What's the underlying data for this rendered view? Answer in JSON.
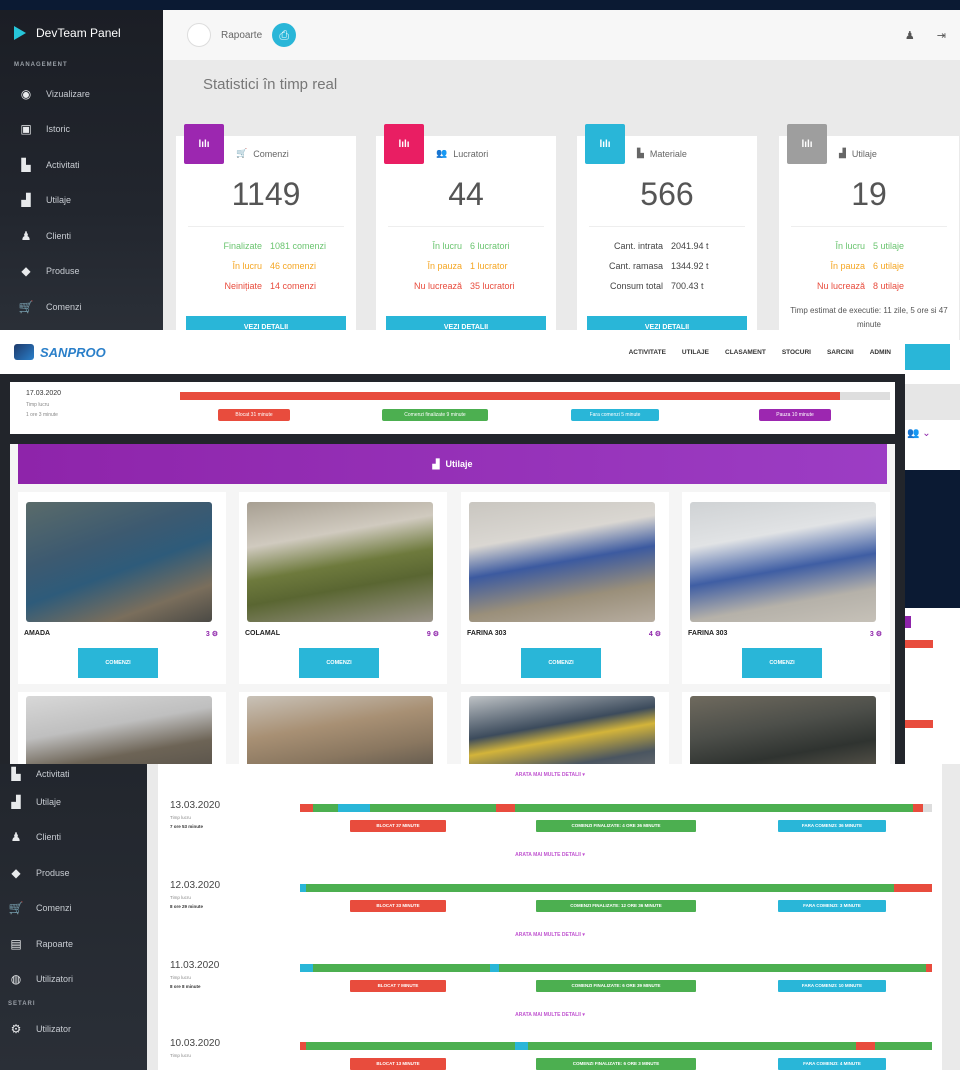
{
  "dashboard": {
    "brand": "DevTeam Panel",
    "section": "MANAGEMENT",
    "nav": [
      {
        "label": "Vizualizare",
        "icon": "eye-icon",
        "glyph": "◉"
      },
      {
        "label": "Istoric",
        "icon": "clipboard-icon",
        "glyph": "▣"
      },
      {
        "label": "Activitati",
        "icon": "chart-icon",
        "glyph": "▙"
      },
      {
        "label": "Utilaje",
        "icon": "factory-icon",
        "glyph": "▟"
      },
      {
        "label": "Clienti",
        "icon": "user-icon",
        "glyph": "♟"
      },
      {
        "label": "Produse",
        "icon": "tag-icon",
        "glyph": "◆"
      },
      {
        "label": "Comenzi",
        "icon": "cart-icon",
        "glyph": "🛒"
      }
    ],
    "top_label": "Rapoarte",
    "title": "Statistici în timp real",
    "cards": [
      {
        "title": "Comenzi",
        "value": "1149",
        "color": "#9c27b0",
        "head_icon": "🛒",
        "rows": [
          [
            "Finalizate",
            "1081 comenzi",
            "green"
          ],
          [
            "În lucru",
            "46 comenzi",
            "orange"
          ],
          [
            "Neinițiate",
            "14 comenzi",
            "red"
          ]
        ],
        "note": "",
        "btn": "VEZI DETALII"
      },
      {
        "title": "Lucratori",
        "value": "44",
        "color": "#e91e63",
        "head_icon": "👥",
        "rows": [
          [
            "În lucru",
            "6 lucratori",
            "green"
          ],
          [
            "În pauza",
            "1 lucrator",
            "orange"
          ],
          [
            "Nu lucrează",
            "35 lucratori",
            "red"
          ]
        ],
        "note": "",
        "btn": "VEZI DETALII"
      },
      {
        "title": "Materiale",
        "value": "566",
        "color": "#29b6d8",
        "head_icon": "▙",
        "rows": [
          [
            "Cant. intrata",
            "2041.94 t",
            "gray"
          ],
          [
            "Cant. ramasa",
            "1344.92 t",
            "gray"
          ],
          [
            "Consum total",
            "700.43 t",
            "gray"
          ]
        ],
        "note": "",
        "btn": "VEZI DETALII"
      },
      {
        "title": "Utilaje",
        "value": "19",
        "color": "#9e9e9e",
        "head_icon": "▟",
        "rows": [
          [
            "În lucru",
            "5 utilaje",
            "green"
          ],
          [
            "În pauza",
            "6 utilaje",
            "orange"
          ],
          [
            "Nu lucrează",
            "8 utilaje",
            "red"
          ]
        ],
        "note": "Timp estimat de executie: 11 zile, 5 ore si 47 minute",
        "btn": ""
      }
    ]
  },
  "utilaje_view": {
    "brand": "SANPROO",
    "nav": [
      "ACTIVITATE",
      "UTILAJE",
      "CLASAMENT",
      "STOCURI",
      "SARCINI",
      "ADMIN"
    ],
    "timeline": {
      "date": "17.03.2020",
      "sub1": "Timp lucru",
      "sub2": "1 ore 3 minute",
      "badges": [
        "Blocat 31 minute",
        "Comenzi finalizate 9 minute",
        "Fara comenzi 5 minute",
        "Pauza 10 minute"
      ]
    },
    "header": "Utilaje",
    "machines": [
      {
        "name": "AMADA",
        "count": "3 ⚙"
      },
      {
        "name": "COLAMAL",
        "count": "9 ⚙"
      },
      {
        "name": "FARINA 303",
        "count": "4 ⚙"
      },
      {
        "name": "FARINA 303",
        "count": "3 ⚙"
      }
    ],
    "machine_btn": "COMENZI"
  },
  "history": {
    "section": "SETARI",
    "nav": [
      {
        "label": "Activitati",
        "icon": "chart-icon",
        "glyph": "▙"
      },
      {
        "label": "Utilaje",
        "icon": "factory-icon",
        "glyph": "▟"
      },
      {
        "label": "Clienti",
        "icon": "user-icon",
        "glyph": "♟"
      },
      {
        "label": "Produse",
        "icon": "tag-icon",
        "glyph": "◆"
      },
      {
        "label": "Comenzi",
        "icon": "cart-icon",
        "glyph": "🛒"
      },
      {
        "label": "Rapoarte",
        "icon": "report-icon",
        "glyph": "▤"
      },
      {
        "label": "Utilizatori",
        "icon": "users-icon",
        "glyph": "◍"
      }
    ],
    "setting_item": {
      "label": "Utilizator",
      "icon": "gear-icon",
      "glyph": "⚙"
    },
    "top_link": "ARATA MAI MULTE DETALII ▾",
    "days": [
      {
        "date": "13.03.2020",
        "sub": "Timp lucru",
        "work": "7 ore 53 minute",
        "badges": [
          "BLOCAT 37 MINUTE",
          "COMENZI FINALIZATE: 4 ORE 36 MINUTE",
          "FARA COMENZI: 36 MINUTE"
        ],
        "link": "ARATA MAI MULTE DETALII ▾"
      },
      {
        "date": "12.03.2020",
        "sub": "Timp lucru",
        "work": "8 ore 29 minute",
        "badges": [
          "BLOCAT 33 MINUTE",
          "COMENZI FINALIZATE: 12 ORE 36 MINUTE",
          "FARA COMENZI: 3 MINUTE"
        ],
        "link": "ARATA MAI MULTE DETALII ▾"
      },
      {
        "date": "11.03.2020",
        "sub": "Timp lucru",
        "work": "8 ore 8 minute",
        "badges": [
          "BLOCAT 7 MINUTE",
          "COMENZI FINALIZATE: 6 ORE 39 MINUTE",
          "FARA COMENZI: 10 MINUTE"
        ],
        "link": "ARATA MAI MULTE DETALII ▾"
      },
      {
        "date": "10.03.2020",
        "sub": "Timp lucru",
        "work": "",
        "badges": [
          "BLOCAT 13 MINUTE",
          "COMENZI FINALIZATE: 6 ORE 3 MINUTE",
          "FARA COMENZI: 4 MINUTE"
        ],
        "link": ""
      }
    ]
  }
}
